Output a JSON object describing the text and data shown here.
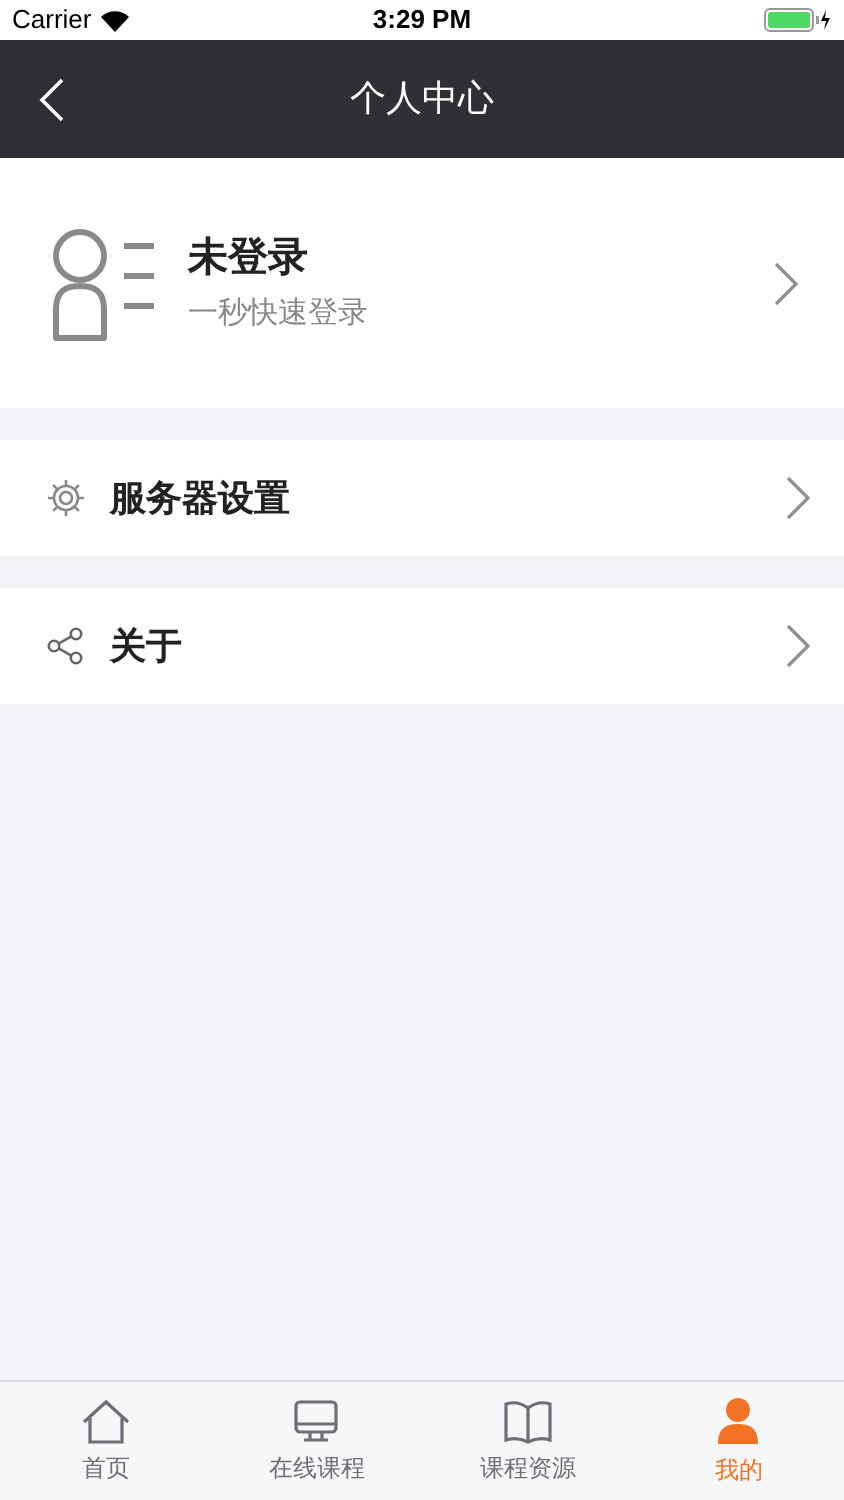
{
  "status_bar": {
    "carrier": "Carrier",
    "time": "3:29 PM"
  },
  "nav": {
    "title": "个人中心"
  },
  "profile": {
    "name": "未登录",
    "subtitle": "一秒快速登录"
  },
  "menu": [
    {
      "kind": "settings",
      "label": "服务器设置"
    },
    {
      "kind": "about",
      "label": "关于"
    }
  ],
  "tabs": [
    {
      "kind": "home",
      "label": "首页",
      "selected": false
    },
    {
      "kind": "monitor",
      "label": "在线课程",
      "selected": false
    },
    {
      "kind": "book",
      "label": "课程资源",
      "selected": false
    },
    {
      "kind": "person",
      "label": "我的",
      "selected": true
    }
  ]
}
